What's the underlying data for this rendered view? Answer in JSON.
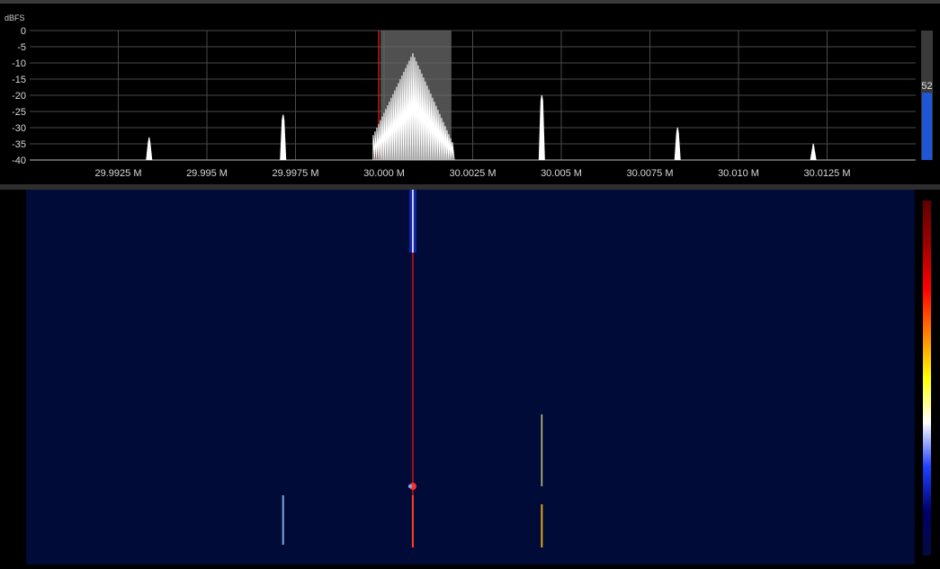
{
  "chart_data": {
    "type": "line",
    "ylabel": "dBFS",
    "ylim": [
      -40,
      0
    ],
    "yticks": [
      0,
      -5,
      -10,
      -15,
      -20,
      -25,
      -30,
      -35,
      -40
    ],
    "xlim": [
      29.99,
      30.015
    ],
    "xticks": [
      29.9925,
      29.995,
      29.9975,
      30.0,
      30.0025,
      30.005,
      30.0075,
      30.01,
      30.0125
    ],
    "xtick_labels": [
      "29.9925 M",
      "29.995 M",
      "29.9975 M",
      "30.000 M",
      "30.0025 M",
      "30.005 M",
      "30.0075 M",
      "30.010 M",
      "30.0125 M"
    ],
    "grid": true,
    "tuned_frequency": 29.99985,
    "filter_band": [
      29.9999,
      30.0019
    ],
    "peaks": [
      {
        "x": 29.99337,
        "y": -33
      },
      {
        "x": 29.99715,
        "y": -26
      },
      {
        "x": 30.00081,
        "y": -7
      },
      {
        "x": 30.00445,
        "y": -20
      },
      {
        "x": 30.00828,
        "y": -30
      },
      {
        "x": 30.01211,
        "y": -35
      }
    ],
    "meter_value": 52,
    "meter_range": [
      0,
      100
    ],
    "colormap": [
      "#000b40",
      "#00006a",
      "#2040ff",
      "#ffffff",
      "#ffff00",
      "#ff8000",
      "#ff0000",
      "#a00000",
      "#600000"
    ]
  }
}
